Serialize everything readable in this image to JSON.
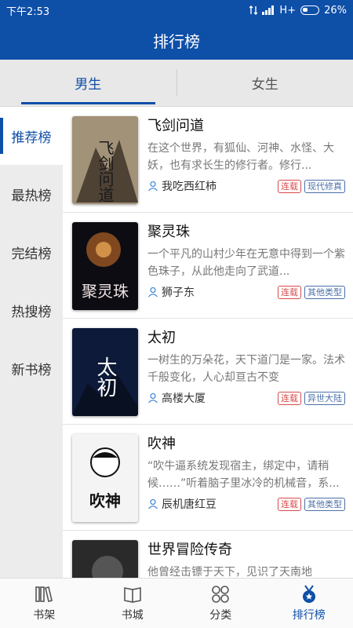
{
  "status": {
    "time": "下午2:53",
    "signal": "H+",
    "battery": "26%"
  },
  "appbar": {
    "title": "排行榜"
  },
  "tabs": [
    {
      "label": "男生",
      "active": true
    },
    {
      "label": "女生",
      "active": false
    }
  ],
  "sidebar": {
    "items": [
      {
        "label": "推荐榜",
        "active": true
      },
      {
        "label": "最热榜"
      },
      {
        "label": "完结榜"
      },
      {
        "label": "热搜榜"
      },
      {
        "label": "新书榜"
      }
    ]
  },
  "books": [
    {
      "title": "飞剑问道",
      "desc": "在这个世界，有狐仙、河神、水怪、大妖，也有求长生的修行者。修行...",
      "author": "我吃西红柿",
      "status": "连载",
      "category": "现代修真",
      "cover_text": "飞剑问道"
    },
    {
      "title": "聚灵珠",
      "desc": "一个平凡的山村少年在无意中得到一个紫色珠子，从此他走向了武道...",
      "author": "狮子东",
      "status": "连载",
      "category": "其他类型",
      "cover_text": "聚灵珠"
    },
    {
      "title": "太初",
      "desc": "一树生的万朵花，天下道门是一家。法术千般变化，人心却亘古不变",
      "author": "高楼大厦",
      "status": "连载",
      "category": "异世大陆",
      "cover_text": "太初"
    },
    {
      "title": "吹神",
      "desc": "“吹牛逼系统发现宿主，绑定中，请稍候……”听着脑子里冰冷的机械音，系...",
      "author": "辰机唐红豆",
      "status": "连载",
      "category": "其他类型",
      "cover_text": "吹神"
    },
    {
      "title": "世界冒险传奇",
      "desc": "他曾经击镖于天下，见识了天南地",
      "author": "",
      "status": "",
      "category": "",
      "cover_text": ""
    }
  ],
  "bottomnav": {
    "items": [
      {
        "label": "书架",
        "icon": "bookshelf-icon"
      },
      {
        "label": "书城",
        "icon": "book-open-icon"
      },
      {
        "label": "分类",
        "icon": "category-grid-icon"
      },
      {
        "label": "排行榜",
        "icon": "ranking-medal-icon",
        "active": true
      }
    ]
  }
}
